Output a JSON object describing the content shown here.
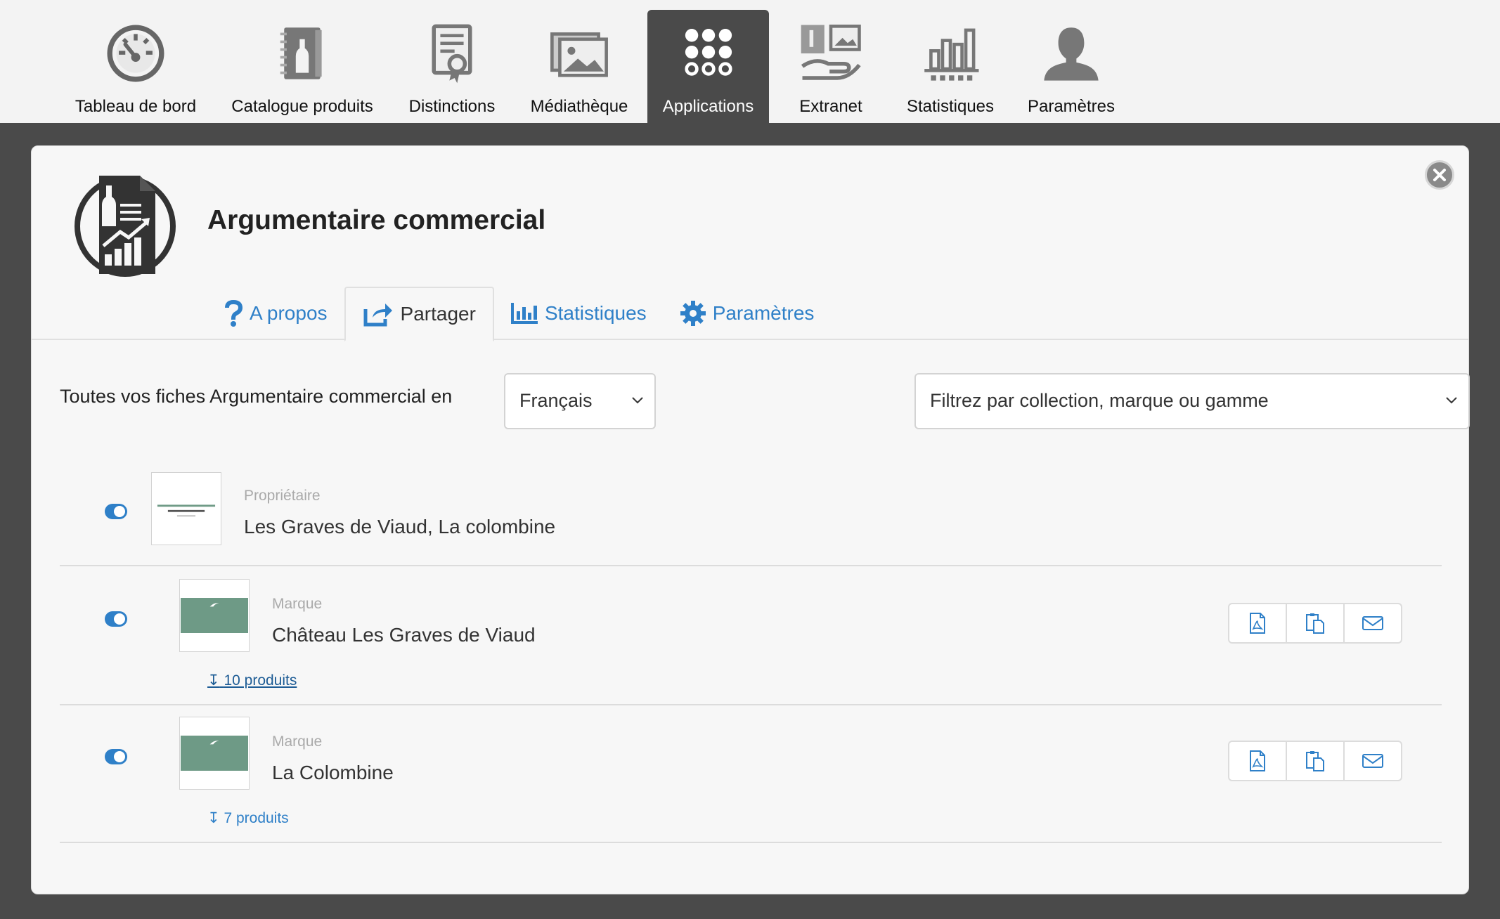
{
  "nav": {
    "items": [
      {
        "label": "Tableau de bord",
        "icon": "dashboard-gauge-icon"
      },
      {
        "label": "Catalogue produits",
        "icon": "catalog-book-icon"
      },
      {
        "label": "Distinctions",
        "icon": "certificate-award-icon"
      },
      {
        "label": "Médiathèque",
        "icon": "media-images-icon"
      },
      {
        "label": "Applications",
        "icon": "apps-grid-icon",
        "active": true
      },
      {
        "label": "Extranet",
        "icon": "extranet-hand-icon"
      },
      {
        "label": "Statistiques",
        "icon": "bar-chart-icon"
      },
      {
        "label": "Paramètres",
        "icon": "user-profile-icon"
      }
    ]
  },
  "modal": {
    "title": "Argumentaire commercial",
    "tabs": [
      {
        "label": "A propos",
        "icon": "question-icon"
      },
      {
        "label": "Partager",
        "icon": "share-icon",
        "active": true
      },
      {
        "label": "Statistiques",
        "icon": "bar-chart-icon"
      },
      {
        "label": "Paramètres",
        "icon": "gear-icon"
      }
    ]
  },
  "filters": {
    "label": "Toutes vos fiches Argumentaire commercial en",
    "language": "Français",
    "collection_placeholder": "Filtrez par collection, marque ou gamme"
  },
  "rows": [
    {
      "type": "Propriétaire",
      "name": "Les Graves de Viaud, La colombine",
      "enabled": true
    },
    {
      "type": "Marque",
      "name": "Château Les Graves de Viaud",
      "products": "10 produits",
      "enabled": true
    },
    {
      "type": "Marque",
      "name": "La Colombine",
      "products": "7 produits",
      "enabled": true
    }
  ],
  "colors": {
    "accent": "#2f80c8",
    "nav_active": "#4a4a4a",
    "thumb_band": "#6e9a86"
  }
}
